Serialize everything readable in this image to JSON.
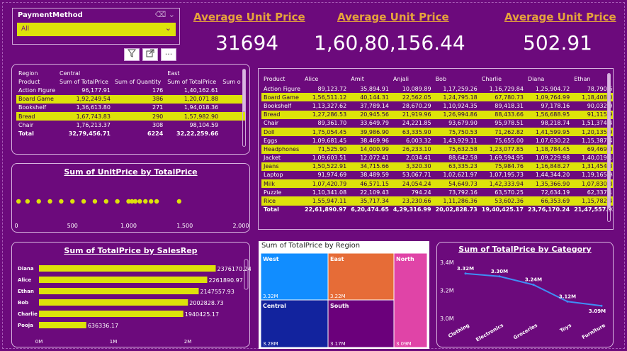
{
  "slicer": {
    "title": "PaymentMethod",
    "value": "All"
  },
  "kpis": [
    {
      "title": "Average Unit Price",
      "value": "31694"
    },
    {
      "title": "Average Unit Price",
      "value": "1,60,80,156.44"
    },
    {
      "title": "Average Unit Price",
      "value": "502.91"
    }
  ],
  "toolbar": {
    "filter": "filter-icon",
    "focus": "focus-icon",
    "more": "more-icon"
  },
  "left_matrix": {
    "header1": [
      "Region",
      "Central",
      "",
      "East",
      ""
    ],
    "header2": [
      "Product",
      "Sum of TotalPrice",
      "Sum of Quantity",
      "Sum of TotalPrice",
      "Sum o"
    ],
    "rows": [
      [
        "Action Figure",
        "96,177.91",
        "176",
        "1,40,162.61",
        ""
      ],
      [
        "Board Game",
        "1,92,249.54",
        "386",
        "1,20,071.88",
        ""
      ],
      [
        "Bookshelf",
        "1,36,613.80",
        "271",
        "1,94,018.36",
        ""
      ],
      [
        "Bread",
        "1,67,743.83",
        "290",
        "1,57,982.90",
        ""
      ],
      [
        "Chair",
        "1,76,213.37",
        "308",
        "98,104.59",
        ""
      ],
      [
        "Total",
        "32,79,456.71",
        "6224",
        "32,22,259.66",
        ""
      ]
    ]
  },
  "right_matrix": {
    "header": [
      "Product",
      "Alice",
      "Amit",
      "Anjali",
      "Bob",
      "Charlie",
      "Diana",
      "Ethan"
    ],
    "rows": [
      [
        "Action Figure",
        "89,123.72",
        "35,894.91",
        "10,089.89",
        "1,17,259.26",
        "1,16,729.84",
        "1,25,904.72",
        "78,790.60"
      ],
      [
        "Board Game",
        "1,56,511.12",
        "40,144.31",
        "22,562.05",
        "1,24,795.18",
        "67,780.73",
        "1,09,764.99",
        "1,18,408.07"
      ],
      [
        "Bookshelf",
        "1,13,327.62",
        "37,789.14",
        "28,670.29",
        "1,10,924.35",
        "89,418.31",
        "97,178.16",
        "90,032.97"
      ],
      [
        "Bread",
        "1,27,286.53",
        "20,945.56",
        "21,919.96",
        "1,26,994.86",
        "88,433.66",
        "1,56,688.95",
        "91,115.95"
      ],
      [
        "Chair",
        "89,361.70",
        "33,649.79",
        "24,221.85",
        "93,679.90",
        "95,978.51",
        "98,218.74",
        "1,51,374.43"
      ],
      [
        "Doll",
        "1,75,054.45",
        "39,986.90",
        "63,335.90",
        "75,750.53",
        "71,262.82",
        "1,41,599.95",
        "1,20,135.97"
      ],
      [
        "Eggs",
        "1,09,681.45",
        "38,469.96",
        "6,003.32",
        "1,43,929.11",
        "75,655.00",
        "1,07,630.22",
        "1,15,387.48"
      ],
      [
        "Headphones",
        "71,525.90",
        "14,000.99",
        "26,233.10",
        "75,632.58",
        "1,23,077.85",
        "1,18,784.45",
        "69,469.09"
      ],
      [
        "Jacket",
        "1,09,603.51",
        "12,072.41",
        "2,034.41",
        "88,642.58",
        "1,69,594.95",
        "1,09,229.98",
        "1,40,019.14"
      ],
      [
        "Jeans",
        "1,50,522.91",
        "34,715.66",
        "3,320.30",
        "63,335.23",
        "75,984.76",
        "1,16,848.27",
        "1,31,454.35"
      ],
      [
        "Laptop",
        "91,974.69",
        "38,489.59",
        "53,067.71",
        "1,02,621.97",
        "1,07,195.73",
        "1,44,344.20",
        "1,19,165.94"
      ],
      [
        "Milk",
        "1,07,420.79",
        "46,571.15",
        "24,054.24",
        "54,649.73",
        "1,42,333.94",
        "1,35,366.90",
        "1,07,830.81"
      ],
      [
        "Puzzle",
        "1,10,341.08",
        "22,109.43",
        "794.24",
        "73,792.16",
        "63,570.25",
        "72,634.19",
        "62,337.16"
      ],
      [
        "Rice",
        "1,55,947.11",
        "35,717.34",
        "23,230.66",
        "1,11,286.36",
        "53,602.36",
        "66,353.69",
        "1,15,782.47"
      ],
      [
        "Total",
        "22,61,890.97",
        "6,20,474.65",
        "4,29,316.99",
        "20,02,828.73",
        "19,40,425.17",
        "23,76,170.24",
        "21,47,557.93"
      ]
    ]
  },
  "colors": {
    "background": "#6c0a7c",
    "highlight": "#dde20a",
    "kpi_title": "#e6a33b",
    "line": "#3f8ef5"
  },
  "scatter": {
    "title": "Sum of UnitPrice by TotalPrice",
    "xticks": [
      "0",
      "500",
      "1,000",
      "1,500",
      "2,000"
    ]
  },
  "salesrep": {
    "title": "Sum of TotalPrice by SalesRep",
    "xticks": [
      "0M",
      "1M",
      "2M"
    ]
  },
  "treemap": {
    "title": "Sum of TotalPrice by Region"
  },
  "category": {
    "title": "Sum of TotalPrice by Category"
  },
  "chart_data": [
    {
      "type": "scatter",
      "title": "Sum of UnitPrice by TotalPrice",
      "xlim": [
        0,
        2000
      ],
      "x": [
        20,
        100,
        200,
        300,
        400,
        500,
        600,
        700,
        800,
        900,
        1000,
        1030,
        1060,
        1100,
        1150,
        1200,
        1250,
        1450
      ],
      "y": [
        1,
        1,
        1,
        1,
        1,
        1,
        1,
        1,
        1,
        1,
        1,
        1,
        1,
        1,
        1,
        1,
        1,
        1
      ]
    },
    {
      "type": "bar",
      "title": "Sum of TotalPrice by SalesRep",
      "categories": [
        "Diana",
        "Alice",
        "Ethan",
        "Bob",
        "Charlie",
        "Pooja"
      ],
      "values": [
        2376170.24,
        2261890.97,
        2147557.93,
        2002828.73,
        1940425.17,
        636336.17
      ],
      "labels": [
        "2376170.24",
        "2261890.97",
        "2147557.93",
        "2002828.73",
        "1940425.17",
        "636336.17"
      ],
      "xlim": [
        0,
        2400000
      ]
    },
    {
      "type": "treemap",
      "title": "Sum of TotalPrice by Region",
      "categories": [
        "West",
        "East",
        "North",
        "Central",
        "South"
      ],
      "values": [
        3.32,
        3.22,
        3.09,
        3.28,
        3.17
      ],
      "labels": [
        "3.32M",
        "3.22M",
        "3.09M",
        "3.28M",
        "3.17M"
      ],
      "colors": [
        "#118dff",
        "#e66c37",
        "#e044a7",
        "#12239e",
        "#6b007b"
      ]
    },
    {
      "type": "line",
      "title": "Sum of TotalPrice by Category",
      "categories": [
        "Clothing",
        "Electronics",
        "Groceries",
        "Toys",
        "Furniture"
      ],
      "values": [
        3.32,
        3.3,
        3.24,
        3.12,
        3.09
      ],
      "labels": [
        "3.32M",
        "3.30M",
        "3.24M",
        "3.12M",
        "3.09M"
      ],
      "yticks": [
        "3.4M",
        "3.2M",
        "3.0M"
      ],
      "ylim": [
        3.0,
        3.4
      ]
    }
  ]
}
